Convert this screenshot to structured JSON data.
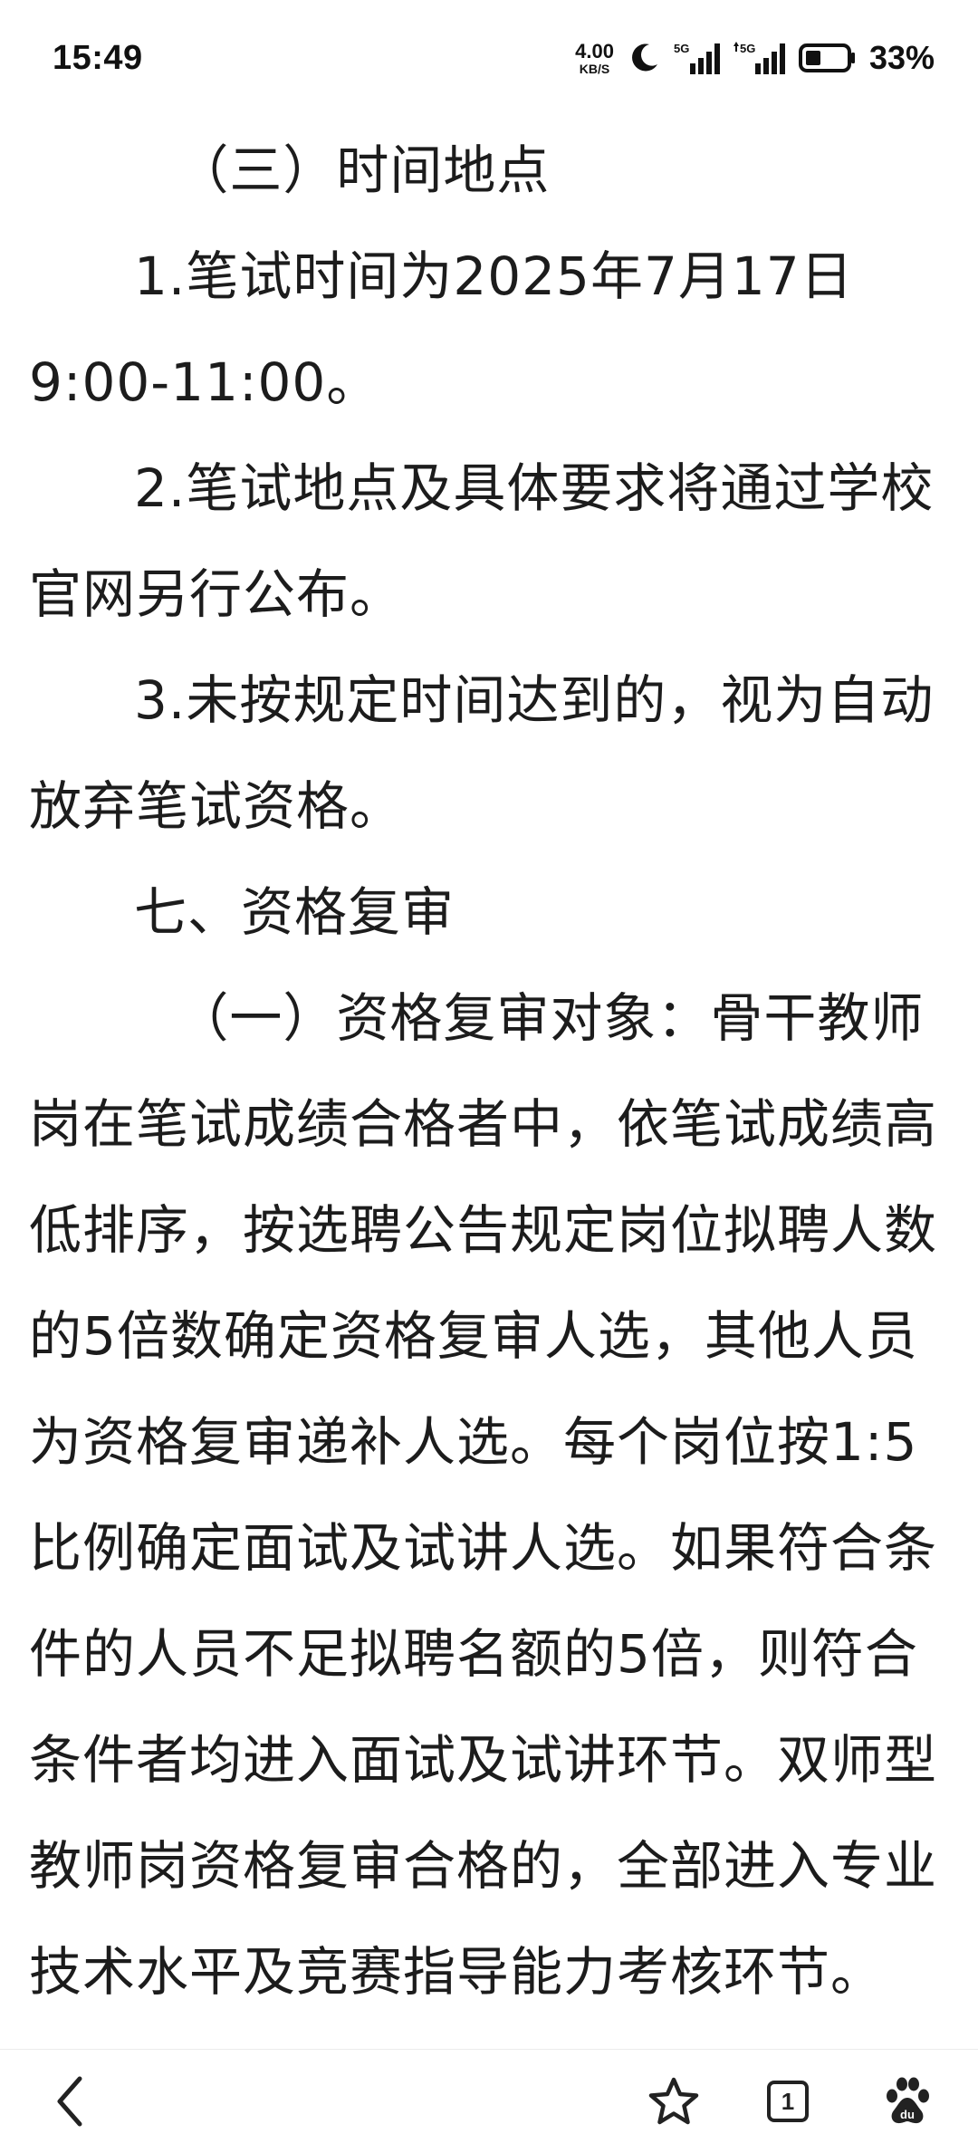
{
  "status_bar": {
    "time": "15:49",
    "net_speed_value": "4.00",
    "net_speed_unit": "KB/S",
    "sim1_label": "5G",
    "sim2_label": "5G",
    "battery_percent": "33%",
    "icons": [
      "moon-icon",
      "signal-icon",
      "signal-icon",
      "battery-icon"
    ]
  },
  "article": {
    "paragraphs": [
      "（三）时间地点",
      "1.笔试时间为2025年7月17日9:00-11:00。",
      "2.笔试地点及具体要求将通过学校官网另行公布。",
      "3.未按规定时间达到的，视为自动放弃笔试资格。",
      "七、资格复审",
      "（一）资格复审对象：骨干教师岗在笔试成绩合格者中，依笔试成绩高低排序，按选聘公告规定岗位拟聘人数的5倍数确定资格复审人选，其他人员为资格复审递补人选。每个岗位按1:5比例确定面试及试讲人选。如果符合条件的人员不足拟聘名额的5倍，则符合条件者均进入面试及试讲环节。双师型教师岗资格复审合格的，全部进入专业技术水平及竞赛指导能力考核环节。"
    ]
  },
  "toolbar": {
    "tab_count": "1",
    "icons": [
      "back-arrow-icon",
      "star-icon",
      "tabs-icon",
      "baidu-paw-icon"
    ]
  }
}
